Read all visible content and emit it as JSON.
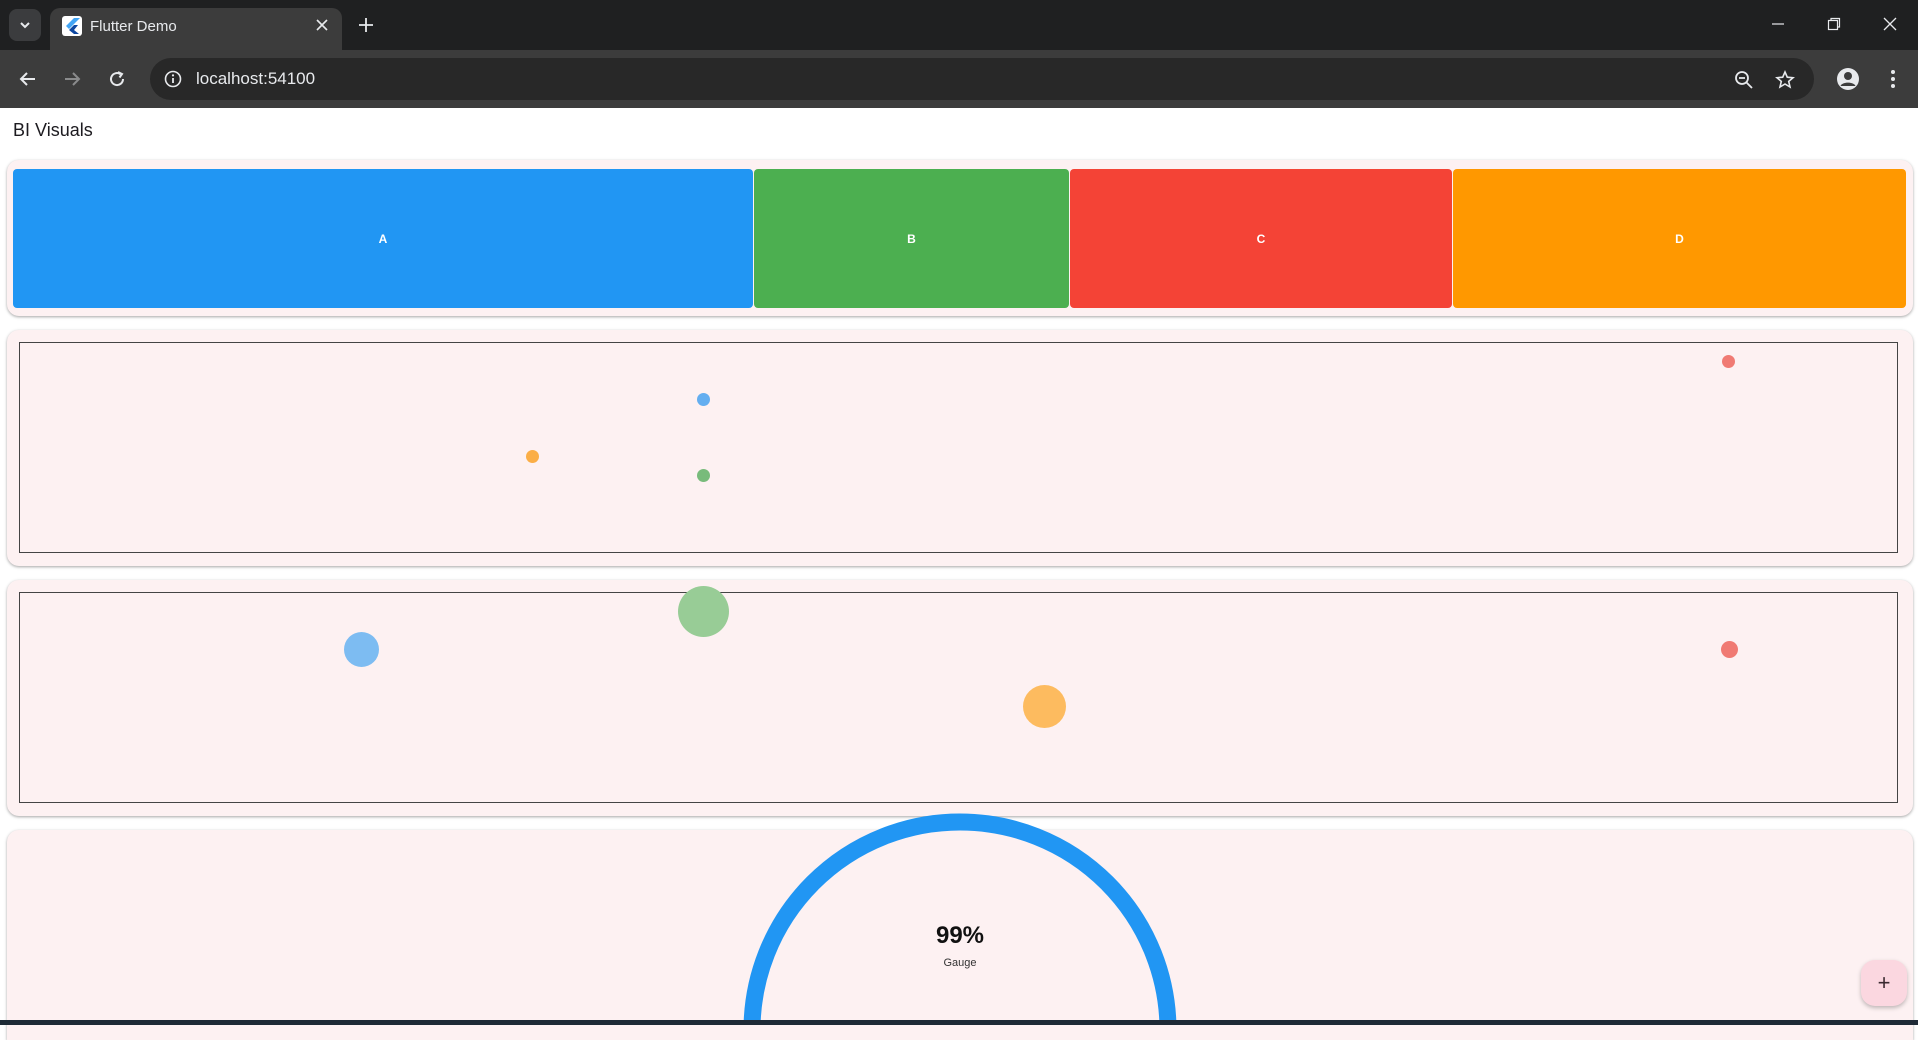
{
  "browser": {
    "tab_title": "Flutter Demo",
    "url": "localhost:54100"
  },
  "app": {
    "title": "BI Visuals"
  },
  "colors": {
    "blue": "#2196f3",
    "green": "#4caf50",
    "red": "#f44336",
    "orange": "#ff9800",
    "card_bg": "#fdf1f2"
  },
  "treemap": {
    "cells": [
      {
        "label": "A",
        "color": "#2196f3"
      },
      {
        "label": "B",
        "color": "#4caf50"
      },
      {
        "label": "C",
        "color": "#f44336"
      },
      {
        "label": "D",
        "color": "#ff9800"
      }
    ]
  },
  "gauge": {
    "value_text": "99%",
    "label": "Gauge",
    "value": 0.99
  },
  "fab": {
    "icon": "plus-icon",
    "label": "+"
  }
}
